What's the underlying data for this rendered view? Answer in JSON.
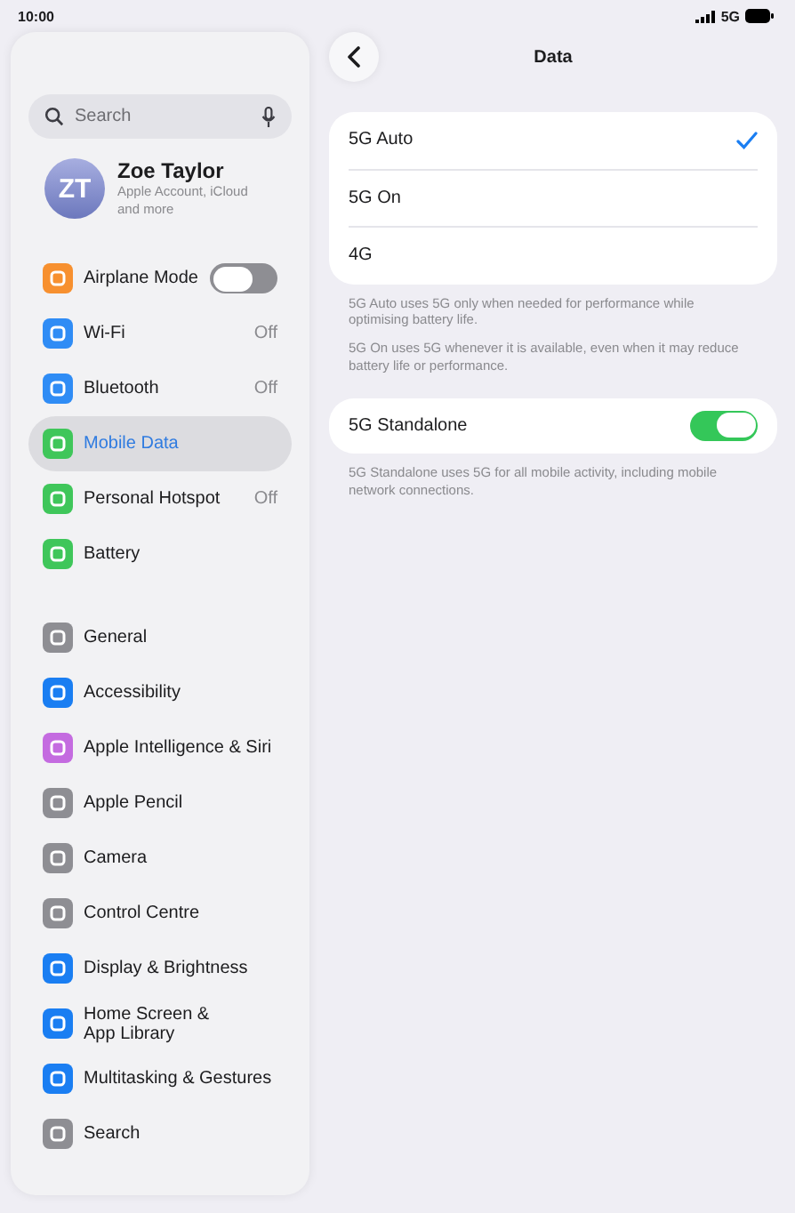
{
  "status_bar": {
    "time": "10:00",
    "network": "5G"
  },
  "sidebar": {
    "search": {
      "placeholder": "Search"
    },
    "profile": {
      "initials": "ZT",
      "name": "Zoe Taylor",
      "subtitle": "Apple Account, iCloud and more"
    },
    "groups": [
      [
        {
          "label": "Airplane Mode",
          "kind": "toggle",
          "on": false,
          "selected": false
        },
        {
          "label": "Wi-Fi",
          "kind": "value",
          "value": "Off",
          "selected": false
        },
        {
          "label": "Bluetooth",
          "kind": "value",
          "value": "Off",
          "selected": false
        },
        {
          "label": "Mobile Data",
          "kind": "plain",
          "selected": true
        },
        {
          "label": "Personal Hotspot",
          "kind": "value",
          "value": "Off",
          "selected": false
        },
        {
          "label": "Battery",
          "kind": "plain",
          "selected": false
        }
      ],
      [
        {
          "label": "General",
          "kind": "plain",
          "selected": false
        },
        {
          "label": "Accessibility",
          "kind": "plain",
          "selected": false
        },
        {
          "label": "Apple Intelligence & Siri",
          "kind": "plain",
          "selected": false
        },
        {
          "label": "Apple Pencil",
          "kind": "plain",
          "selected": false
        },
        {
          "label": "Camera",
          "kind": "plain",
          "selected": false
        },
        {
          "label": "Control Centre",
          "kind": "plain",
          "selected": false
        },
        {
          "label": "Display & Brightness",
          "kind": "plain",
          "selected": false
        },
        {
          "label": "Home Screen & App Library",
          "kind": "plain",
          "selected": false
        },
        {
          "label": "Multitasking & Gestures",
          "kind": "plain",
          "selected": false
        },
        {
          "label": "Search",
          "kind": "plain",
          "selected": false
        }
      ]
    ]
  },
  "detail": {
    "title": "Data",
    "options": [
      {
        "label": "5G Auto",
        "selected": true
      },
      {
        "label": "5G On",
        "selected": false
      },
      {
        "label": "4G",
        "selected": false
      }
    ],
    "notes": [
      "5G Auto uses 5G only when needed for performance while optimising battery life.",
      "5G On uses 5G whenever it is available, even when it may reduce battery life or performance."
    ],
    "standalone": {
      "label": "5G Standalone",
      "on": true,
      "note": "5G Standalone uses 5G for all mobile activity, including mobile network connections."
    }
  }
}
